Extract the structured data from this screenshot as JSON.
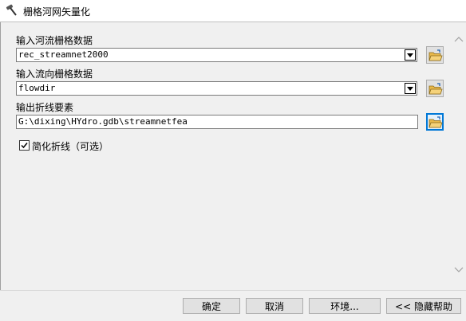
{
  "window": {
    "title": "栅格河网矢量化",
    "icon": "hammer-icon"
  },
  "form": {
    "input_stream_label": "输入河流栅格数据",
    "input_stream_value": "rec_streamnet2000",
    "input_flowdir_label": "输入流向栅格数据",
    "input_flowdir_value": "flowdir",
    "output_label": "输出折线要素",
    "output_value": "G:\\dixing\\HYdro.gdb\\streamnetfea",
    "simplify_label": "简化折线（可选）",
    "simplify_checked": true
  },
  "buttons": {
    "ok": "确定",
    "cancel": "取消",
    "environments": "环境...",
    "hide_help": "<< 隐藏帮助"
  },
  "icons": {
    "browse": "open-folder-icon",
    "dropdown": "chevron-down-icon",
    "scroll_up": "scroll-up-icon",
    "scroll_down": "scroll-down-icon",
    "check": "check-icon"
  },
  "colors": {
    "focus_border": "#0078d7",
    "window_bg": "#f0f0f0",
    "folder_yellow": "#e8b84a"
  }
}
